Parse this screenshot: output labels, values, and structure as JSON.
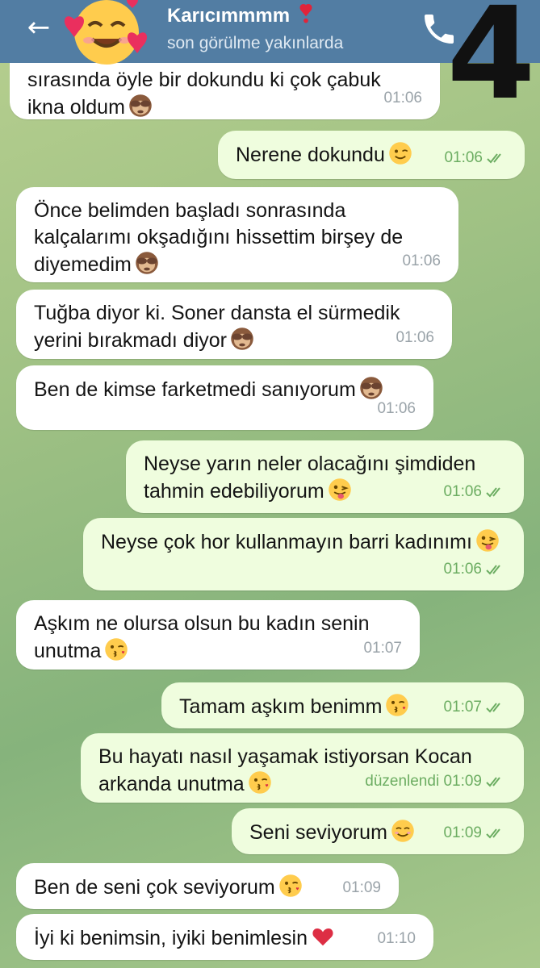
{
  "header": {
    "title": "Karıcımmmm",
    "subtitle": "son görülme yakınlarda",
    "badge": "4"
  },
  "messages": [
    {
      "dir": "in",
      "text": "sırasında öyle bir dokundu ki çok çabuk ikna oldum",
      "emoji": "see-no-evil-monkey",
      "time": "01:06"
    },
    {
      "dir": "out",
      "text": "Nerene dokundu",
      "emoji": "winking-face",
      "time": "01:06"
    },
    {
      "dir": "in",
      "text": "Önce belimden başladı sonrasında kalçalarımı okşadığını hissettim birşey de diyemedim",
      "emoji": "see-no-evil-monkey",
      "time": "01:06"
    },
    {
      "dir": "in",
      "text": "Tuğba diyor ki. Soner dansta el sürmedik yerini bırakmadı  diyor",
      "emoji": "see-no-evil-monkey",
      "time": "01:06"
    },
    {
      "dir": "in",
      "text": "Ben de kimse farketmedi sanıyorum",
      "emoji": "see-no-evil-monkey",
      "time": "01:06"
    },
    {
      "dir": "out",
      "text": "Neyse yarın neler olacağını şimdiden tahmin edebiliyorum",
      "emoji": "winking-tongue-face",
      "time": "01:06"
    },
    {
      "dir": "out",
      "text": "Neyse çok hor kullanmayın barri kadınımı",
      "emoji": "winking-tongue-face",
      "time": "01:06"
    },
    {
      "dir": "in",
      "text": "Aşkım ne olursa olsun bu kadın senin unutma",
      "emoji": "kissing-face",
      "time": "01:07"
    },
    {
      "dir": "out",
      "text": "Tamam aşkım benimm",
      "emoji": "kissing-face",
      "time": "01:07"
    },
    {
      "dir": "out",
      "text": "Bu hayatı nasıl yaşamak istiyorsan Kocan arkanda unutma",
      "emoji": "kissing-face",
      "time": "düzenlendi 01:09"
    },
    {
      "dir": "out",
      "text": "Seni seviyorum",
      "emoji": "smiling-face",
      "time": "01:09"
    },
    {
      "dir": "in",
      "text": "Ben de seni çok seviyorum",
      "emoji": "kissing-face",
      "time": "01:09"
    },
    {
      "dir": "in",
      "text": "İyi ki benimsin, iyiki benimlesin",
      "emoji": "red-heart",
      "time": "01:10"
    }
  ]
}
